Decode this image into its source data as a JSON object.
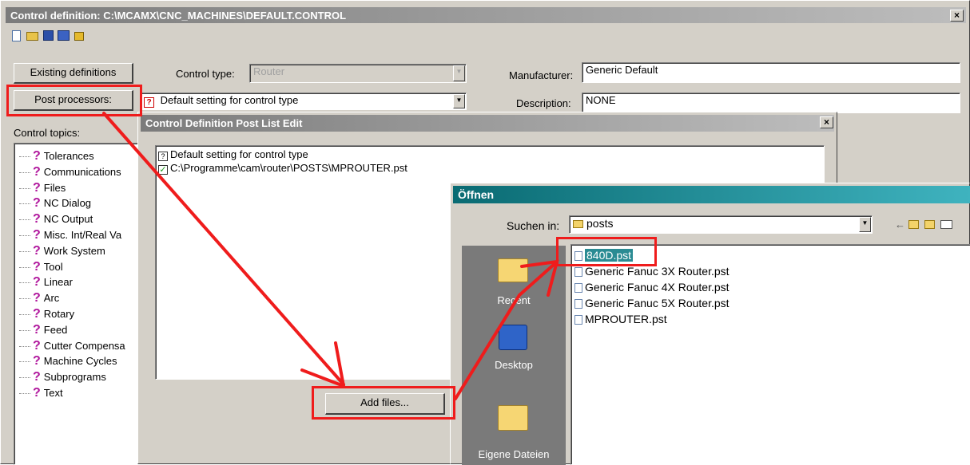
{
  "main_window": {
    "title": "Control definition: C:\\MCAMX\\CNC_MACHINES\\DEFAULT.CONTROL",
    "close_glyph": "×",
    "toolbar_icons": [
      "new-file-icon",
      "open-file-icon",
      "save-icon",
      "save-as-icon",
      "unlock-icon"
    ],
    "existing_definitions_label": "Existing definitions",
    "post_processors_label": "Post processors:",
    "control_type_label": "Control type:",
    "control_type_value": "Router",
    "post_value": "Default setting for control type",
    "manufacturer_label": "Manufacturer:",
    "manufacturer_value": "Generic Default",
    "description_label": "Description:",
    "description_value": "NONE",
    "control_topics_label": "Control topics:",
    "topics": [
      "Tolerances",
      "Communications",
      "Files",
      "NC Dialog",
      "NC Output",
      "Misc. Int/Real Va",
      "Work System",
      "Tool",
      "Linear",
      "Arc",
      "Rotary",
      "Feed",
      "Cutter Compensa",
      "Machine Cycles",
      "Subprograms",
      "Text"
    ]
  },
  "post_list_dialog": {
    "title": "Control Definition Post List Edit",
    "close_glyph": "×",
    "items": [
      "Default setting for control type",
      "C:\\Programme\\cam\\router\\POSTS\\MPROUTER.pst"
    ],
    "add_files_label": "Add files..."
  },
  "open_dialog": {
    "title": "Öffnen",
    "look_in_label": "Suchen in:",
    "look_in_value": "posts",
    "places": [
      "Recent",
      "Desktop",
      "Eigene Dateien"
    ],
    "files": [
      "840D.pst",
      "Generic Fanuc 3X Router.pst",
      "Generic Fanuc 4X Router.pst",
      "Generic Fanuc 5X Router.pst",
      "MPROUTER.pst"
    ],
    "selected_file": "840D.pst"
  },
  "colors": {
    "annotation_red": "#ef1c1c",
    "question_icon": "#b0169c",
    "selection": "#2a8b93"
  }
}
